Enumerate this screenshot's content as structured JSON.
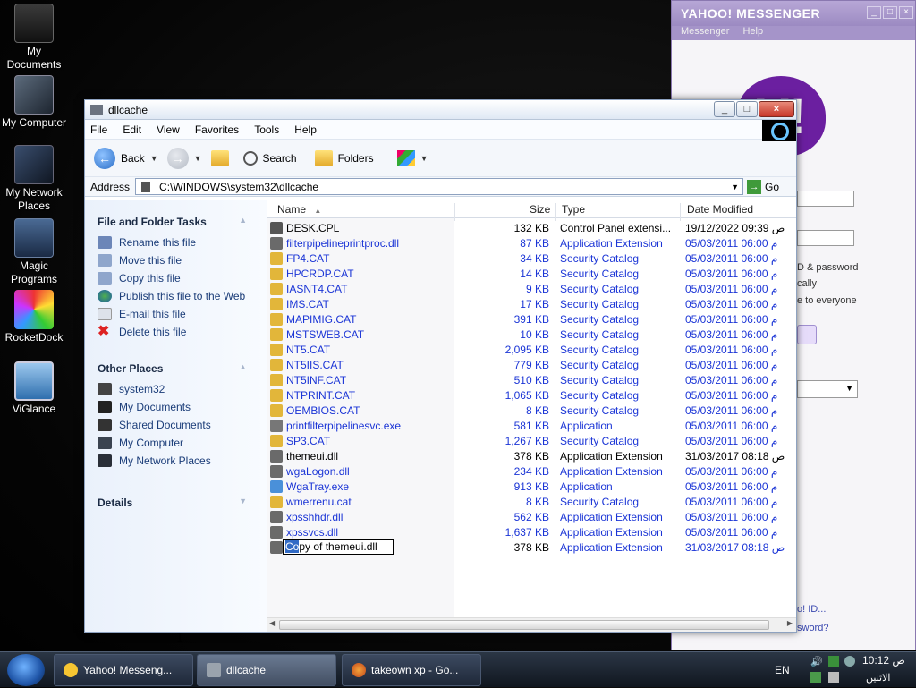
{
  "desktop_icons": [
    {
      "label": "My Documents",
      "icon": "folder-stack-icon"
    },
    {
      "label": "My Computer",
      "icon": "computer-icon"
    },
    {
      "label": "My Network Places",
      "icon": "network-icon"
    },
    {
      "label": "Magic Programs",
      "icon": "castle-icon"
    },
    {
      "label": "RocketDock",
      "icon": "rocketdock-icon"
    },
    {
      "label": "ViGlance",
      "icon": "monitor-icon"
    }
  ],
  "yahoo": {
    "title": "YAHOO! MESSENGER",
    "menu": [
      "Messenger",
      "Help"
    ],
    "text1": "D & password",
    "text2": "cally",
    "text3": "e to everyone",
    "link1": "o! ID...",
    "link2": "sword?"
  },
  "window": {
    "title": "dllcache",
    "menu": [
      "File",
      "Edit",
      "View",
      "Favorites",
      "Tools",
      "Help"
    ],
    "toolbar": {
      "back": "Back",
      "search": "Search",
      "folders": "Folders"
    },
    "address": {
      "label": "Address",
      "path": "C:\\WINDOWS\\system32\\dllcache",
      "go": "Go"
    }
  },
  "taskpane": {
    "file_tasks_title": "File and Folder Tasks",
    "file_tasks": [
      {
        "label": "Rename this file",
        "icon": "rename-icon"
      },
      {
        "label": "Move this file",
        "icon": "move-icon"
      },
      {
        "label": "Copy this file",
        "icon": "copy-icon"
      },
      {
        "label": "Publish this file to the Web",
        "icon": "globe-icon"
      },
      {
        "label": "E-mail this file",
        "icon": "email-icon"
      },
      {
        "label": "Delete this file",
        "icon": "delete-icon"
      }
    ],
    "other_places_title": "Other Places",
    "other_places": [
      {
        "label": "system32",
        "icon": "folder-icon"
      },
      {
        "label": "My Documents",
        "icon": "documents-icon"
      },
      {
        "label": "Shared Documents",
        "icon": "shared-folder-icon"
      },
      {
        "label": "My Computer",
        "icon": "computer-icon"
      },
      {
        "label": "My Network Places",
        "icon": "network-icon"
      }
    ],
    "details_title": "Details"
  },
  "columns": {
    "name": "Name",
    "size": "Size",
    "type": "Type",
    "date": "Date Modified"
  },
  "files": [
    {
      "name": "DESK.CPL",
      "size": "132 KB",
      "type": "Control Panel extensi...",
      "date": "19/12/2022 09:39 ص",
      "blue": false,
      "icon": "cpl-icon"
    },
    {
      "name": "filterpipelineprintproc.dll",
      "size": "87 KB",
      "type": "Application Extension",
      "date": "05/03/2011 06:00 م",
      "blue": true,
      "icon": "dll-icon"
    },
    {
      "name": "FP4.CAT",
      "size": "34 KB",
      "type": "Security Catalog",
      "date": "05/03/2011 06:00 م",
      "blue": true,
      "icon": "catalog-icon"
    },
    {
      "name": "HPCRDP.CAT",
      "size": "14 KB",
      "type": "Security Catalog",
      "date": "05/03/2011 06:00 م",
      "blue": true,
      "icon": "catalog-icon"
    },
    {
      "name": "IASNT4.CAT",
      "size": "9 KB",
      "type": "Security Catalog",
      "date": "05/03/2011 06:00 م",
      "blue": true,
      "icon": "catalog-icon"
    },
    {
      "name": "IMS.CAT",
      "size": "17 KB",
      "type": "Security Catalog",
      "date": "05/03/2011 06:00 م",
      "blue": true,
      "icon": "catalog-icon"
    },
    {
      "name": "MAPIMIG.CAT",
      "size": "391 KB",
      "type": "Security Catalog",
      "date": "05/03/2011 06:00 م",
      "blue": true,
      "icon": "catalog-icon"
    },
    {
      "name": "MSTSWEB.CAT",
      "size": "10 KB",
      "type": "Security Catalog",
      "date": "05/03/2011 06:00 م",
      "blue": true,
      "icon": "catalog-icon"
    },
    {
      "name": "NT5.CAT",
      "size": "2,095 KB",
      "type": "Security Catalog",
      "date": "05/03/2011 06:00 م",
      "blue": true,
      "icon": "catalog-icon"
    },
    {
      "name": "NT5IIS.CAT",
      "size": "779 KB",
      "type": "Security Catalog",
      "date": "05/03/2011 06:00 م",
      "blue": true,
      "icon": "catalog-icon"
    },
    {
      "name": "NT5INF.CAT",
      "size": "510 KB",
      "type": "Security Catalog",
      "date": "05/03/2011 06:00 م",
      "blue": true,
      "icon": "catalog-icon"
    },
    {
      "name": "NTPRINT.CAT",
      "size": "1,065 KB",
      "type": "Security Catalog",
      "date": "05/03/2011 06:00 م",
      "blue": true,
      "icon": "catalog-icon"
    },
    {
      "name": "OEMBIOS.CAT",
      "size": "8 KB",
      "type": "Security Catalog",
      "date": "05/03/2011 06:00 م",
      "blue": true,
      "icon": "catalog-icon"
    },
    {
      "name": "printfilterpipelinesvc.exe",
      "size": "581 KB",
      "type": "Application",
      "date": "05/03/2011 06:00 م",
      "blue": true,
      "icon": "exe-icon"
    },
    {
      "name": "SP3.CAT",
      "size": "1,267 KB",
      "type": "Security Catalog",
      "date": "05/03/2011 06:00 م",
      "blue": true,
      "icon": "catalog-icon"
    },
    {
      "name": "themeui.dll",
      "size": "378 KB",
      "type": "Application Extension",
      "date": "31/03/2017 08:18 ص",
      "blue": false,
      "icon": "dll-icon"
    },
    {
      "name": "wgaLogon.dll",
      "size": "234 KB",
      "type": "Application Extension",
      "date": "05/03/2011 06:00 م",
      "blue": true,
      "icon": "dll-icon"
    },
    {
      "name": "WgaTray.exe",
      "size": "913 KB",
      "type": "Application",
      "date": "05/03/2011 06:00 م",
      "blue": true,
      "icon": "wga-star-icon"
    },
    {
      "name": "wmerrenu.cat",
      "size": "8 KB",
      "type": "Security Catalog",
      "date": "05/03/2011 06:00 م",
      "blue": true,
      "icon": "catalog-icon"
    },
    {
      "name": "xpsshhdr.dll",
      "size": "562 KB",
      "type": "Application Extension",
      "date": "05/03/2011 06:00 م",
      "blue": true,
      "icon": "dll-icon"
    },
    {
      "name": "xpssvcs.dll",
      "size": "1,637 KB",
      "type": "Application Extension",
      "date": "05/03/2011 06:00 م",
      "blue": true,
      "icon": "dll-icon"
    }
  ],
  "renaming_file": {
    "selected_part": "Co",
    "rest": "py of themeui.dll",
    "size": "378 KB",
    "type": "Application Extension",
    "date": "31/03/2017 08:18 ص"
  },
  "taskbar": {
    "tasks": [
      {
        "label": "Yahoo! Messeng...",
        "icon": "yahoo-smiley-icon",
        "active": false
      },
      {
        "label": "dllcache",
        "icon": "folder-icon",
        "active": true
      },
      {
        "label": "takeown xp - Go...",
        "icon": "firefox-icon",
        "active": false
      }
    ],
    "lang": "EN",
    "time": "10:12 ص",
    "day": "الاثنين"
  }
}
